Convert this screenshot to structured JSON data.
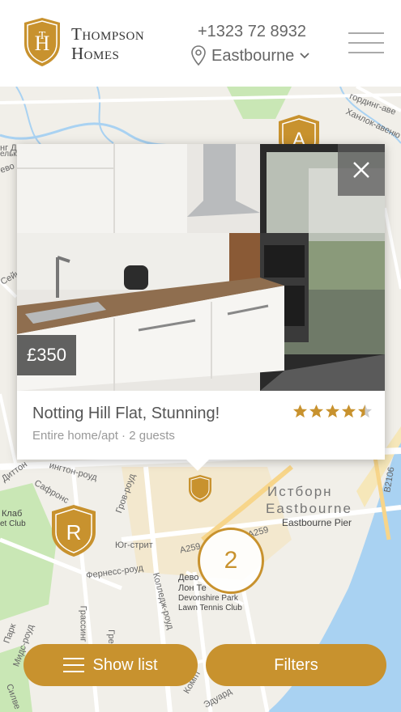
{
  "header": {
    "brand_line1": "Thompson",
    "brand_line2": "Homes",
    "phone": "+1323 72 8932",
    "location": "Eastbourne"
  },
  "map": {
    "labels": {
      "eastbourne_ru": "Истборн",
      "eastbourne_en": "Eastbourne",
      "pier": "Eastbourne Pier",
      "devonshire": "Devonshire Park",
      "lawn_tennis": "Lawn Tennis Club",
      "devon_ru": "Дево",
      "lon_te": "Лон Те",
      "club": "Клаб",
      "et_club": "et Club",
      "ug_street": "Юг-стрит",
      "a259": "A259",
      "b2106": "B2106",
      "ferness": "Фернесс-роуд",
      "college": "Колледж-роуд",
      "saffrons": "Сафронс",
      "grove": "Гров-роуд",
      "grassington": "Грассинг",
      "grey": "Грей",
      "mids": "Мидс-роуд",
      "compton": "Компт",
      "park": "Парк",
      "silver": "Силве",
      "edward": "Эдуард",
      "ditton": "Диттон",
      "seyn": "Сейн",
      "chanlok": "Ханлок-авеню",
      "dng": "нг Д",
      "ven": "ево",
      "elk": "ельк",
      "gording": "гординг-аве",
      "a259_2": "A259",
      "hington": "ингтон-роуд"
    },
    "markers": [
      {
        "letter": "A"
      },
      {
        "letter": "R"
      }
    ],
    "cluster_count": "2"
  },
  "card": {
    "price": "£350",
    "title": "Notting Hill Flat, Stunning!",
    "subtitle": "Entire home/apt · 2 guests",
    "rating": 4.5,
    "rating_max": 5
  },
  "buttons": {
    "show_list": "Show list",
    "filters": "Filters"
  },
  "colors": {
    "accent": "#c8922e",
    "water": "#a9d2f2",
    "park": "#c9e7b5",
    "star": "#c8922e"
  }
}
